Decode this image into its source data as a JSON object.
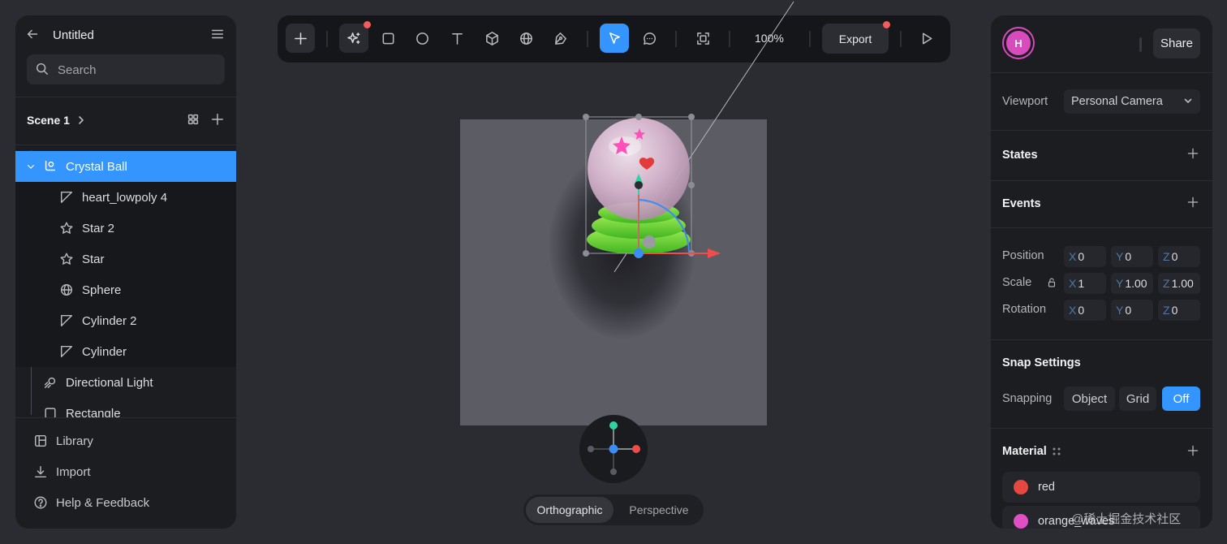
{
  "document": {
    "title": "Untitled"
  },
  "layers": {
    "search_placeholder": "Search",
    "scene_label": "Scene 1",
    "items": [
      {
        "label": "Crystal Ball",
        "icon": "group-icon",
        "selected": true
      },
      {
        "label": "heart_lowpoly 4",
        "icon": "mesh-icon"
      },
      {
        "label": "Star 2",
        "icon": "star-icon"
      },
      {
        "label": "Star",
        "icon": "star-icon"
      },
      {
        "label": "Sphere",
        "icon": "sphere-icon"
      },
      {
        "label": "Cylinder 2",
        "icon": "mesh-icon"
      },
      {
        "label": "Cylinder",
        "icon": "mesh-icon"
      },
      {
        "label": "Directional Light",
        "icon": "light-icon"
      },
      {
        "label": "Rectangle",
        "icon": "rectangle-icon"
      }
    ]
  },
  "footer_links": [
    {
      "label": "Library",
      "icon": "library-icon"
    },
    {
      "label": "Import",
      "icon": "import-icon"
    },
    {
      "label": "Help & Feedback",
      "icon": "help-icon"
    }
  ],
  "toolbar": {
    "zoom": "100%",
    "export_label": "Export"
  },
  "viewport_toggle": {
    "active": "Orthographic",
    "inactive": "Perspective"
  },
  "user": {
    "initial": "H",
    "avatar_color": "#d84bbd"
  },
  "share_label": "Share",
  "properties": {
    "viewport_label": "Viewport",
    "viewport_value": "Personal Camera",
    "states_label": "States",
    "events_label": "Events",
    "position": {
      "label": "Position",
      "x": "0",
      "y": "0",
      "z": "0"
    },
    "scale": {
      "label": "Scale",
      "x": "1",
      "y": "1.00",
      "z": "1.00"
    },
    "rotation": {
      "label": "Rotation",
      "x": "0",
      "y": "0",
      "z": "0"
    },
    "axis_labels": {
      "x": "X",
      "y": "Y",
      "z": "Z"
    },
    "snap_heading": "Snap Settings",
    "snapping_label": "Snapping",
    "snapping_options": [
      "Object",
      "Grid",
      "Off"
    ],
    "snapping_selected": "Off",
    "material_heading": "Material",
    "materials": [
      {
        "name": "red",
        "color": "#e5483f"
      },
      {
        "name": "orange_waves",
        "color": "#e04fc4"
      }
    ]
  },
  "accent_color": "#3395fd",
  "watermark": "@稀土掘金技术社区"
}
